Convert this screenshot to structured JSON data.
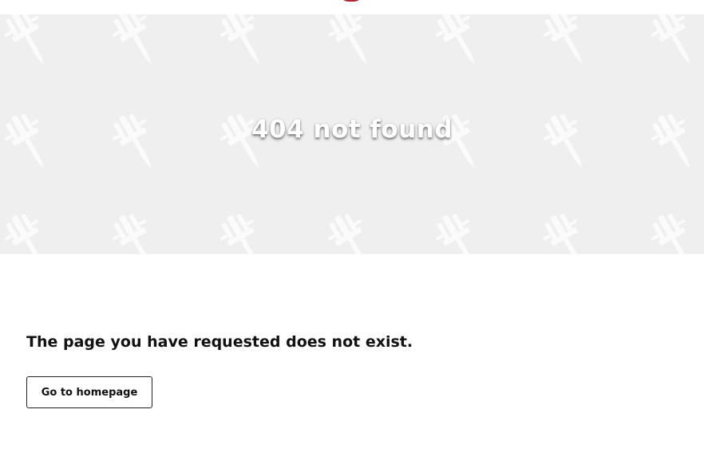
{
  "header": {
    "logo_icon": "brand-logo-icon",
    "logo_color": "#b3202f"
  },
  "hero": {
    "title": "404 not found",
    "background_color": "#efefef",
    "pattern_icon": "tattoo-machine-icon"
  },
  "main": {
    "message": "The page you have requested does not exist.",
    "home_button_label": "Go to homepage"
  }
}
